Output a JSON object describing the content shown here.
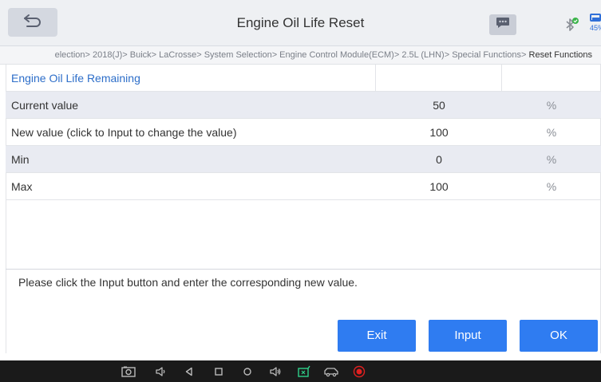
{
  "header": {
    "title": "Engine Oil Life Reset",
    "battery_percent": "45%"
  },
  "breadcrumb": {
    "path": "election> 2018(J)> Buick> LaCrosse> System Selection> Engine Control Module(ECM)> 2.5L (LHN)> Special Functions> ",
    "current": "Reset Functions"
  },
  "table": {
    "header": "Engine Oil Life Remaining",
    "rows": [
      {
        "label": "Current value",
        "value": "50",
        "unit": "%"
      },
      {
        "label": "New value (click to Input to change the value)",
        "value": "100",
        "unit": "%"
      },
      {
        "label": "Min",
        "value": "0",
        "unit": "%"
      },
      {
        "label": "Max",
        "value": "100",
        "unit": "%"
      }
    ]
  },
  "message": "Please click the Input button and enter the corresponding new value.",
  "buttons": {
    "exit": "Exit",
    "input": "Input",
    "ok": "OK"
  },
  "icons": {
    "back": "back-arrow-icon",
    "message": "chat-icon",
    "bluetooth": "bluetooth-connected-icon",
    "battery": "battery-icon",
    "nav": [
      "screenshot-icon",
      "volume-down-icon",
      "back-triangle-icon",
      "recents-icon",
      "home-icon",
      "volume-up-icon",
      "vci-icon",
      "vehicle-icon",
      "record-icon"
    ]
  },
  "colors": {
    "accent": "#2f7cf1",
    "header_text": "#2d6ec9",
    "shaded_row": "#e9ebf2",
    "bluetooth_ok": "#3bb44a",
    "record": "#e02020"
  }
}
